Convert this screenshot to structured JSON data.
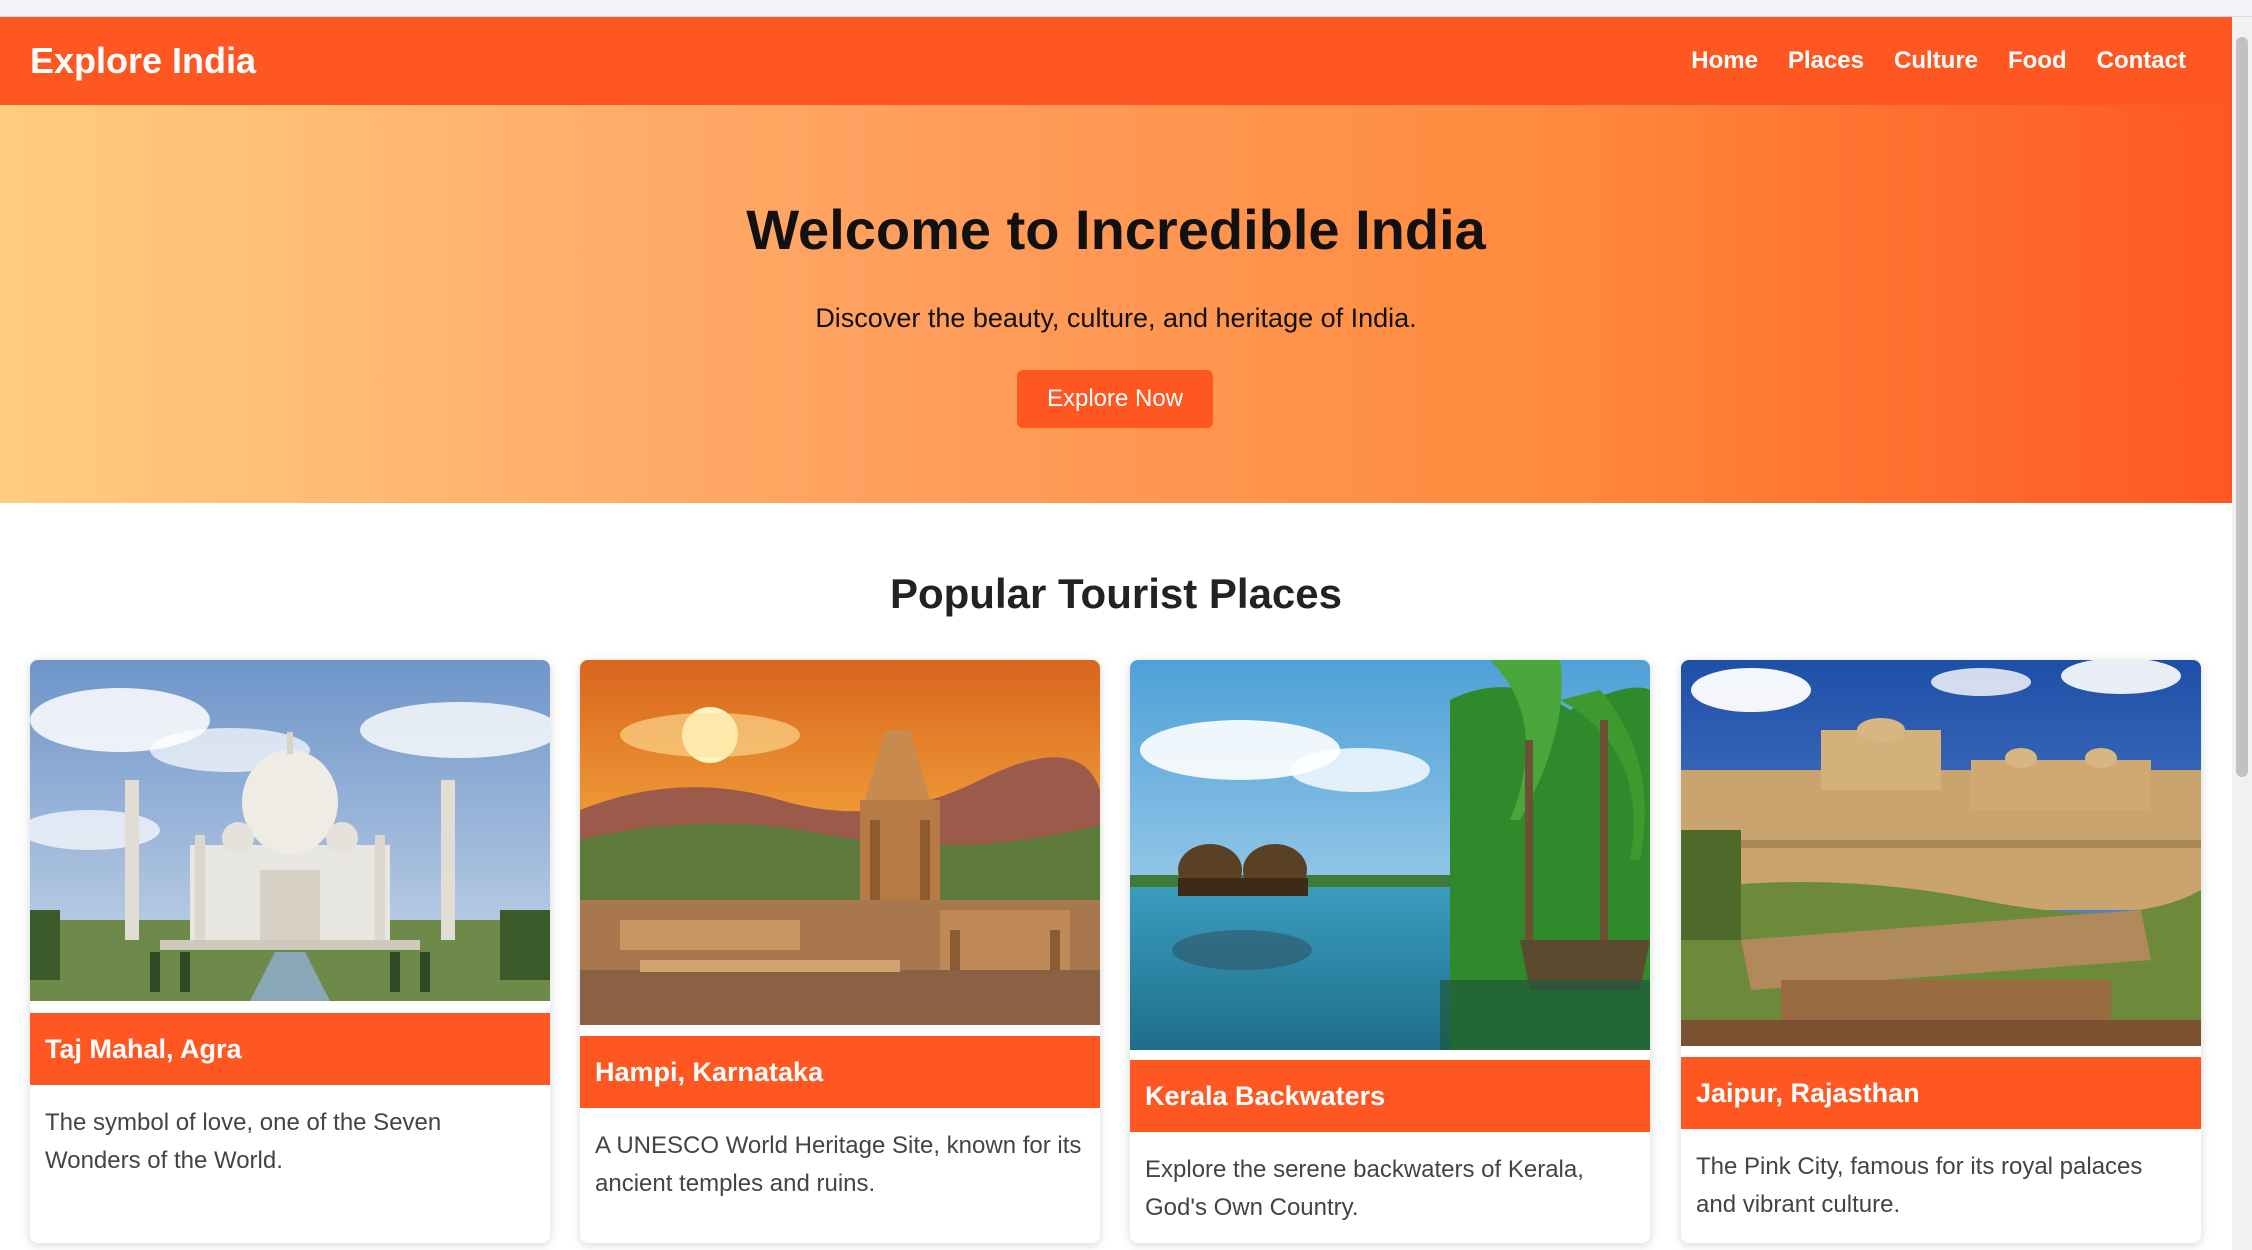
{
  "navbar": {
    "brand": "Explore India",
    "links": [
      "Home",
      "Places",
      "Culture",
      "Food",
      "Contact"
    ]
  },
  "hero": {
    "title": "Welcome to Incredible India",
    "subtitle": "Discover the beauty, culture, and heritage of India.",
    "button": "Explore Now"
  },
  "places": {
    "title": "Popular Tourist Places",
    "cards": [
      {
        "title": "Taj Mahal, Agra",
        "description": "The symbol of love, one of the Seven Wonders of the World."
      },
      {
        "title": "Hampi, Karnataka",
        "description": "A UNESCO World Heritage Site, known for its ancient temples and ruins."
      },
      {
        "title": "Kerala Backwaters",
        "description": "Explore the serene backwaters of Kerala, God's Own Country."
      },
      {
        "title": "Jaipur, Rajasthan",
        "description": "The Pink City, famous for its royal palaces and vibrant culture."
      }
    ]
  },
  "colors": {
    "accent": "#ff5722",
    "hero_gradient_start": "#ffcc80",
    "hero_gradient_end": "#ff5722"
  }
}
